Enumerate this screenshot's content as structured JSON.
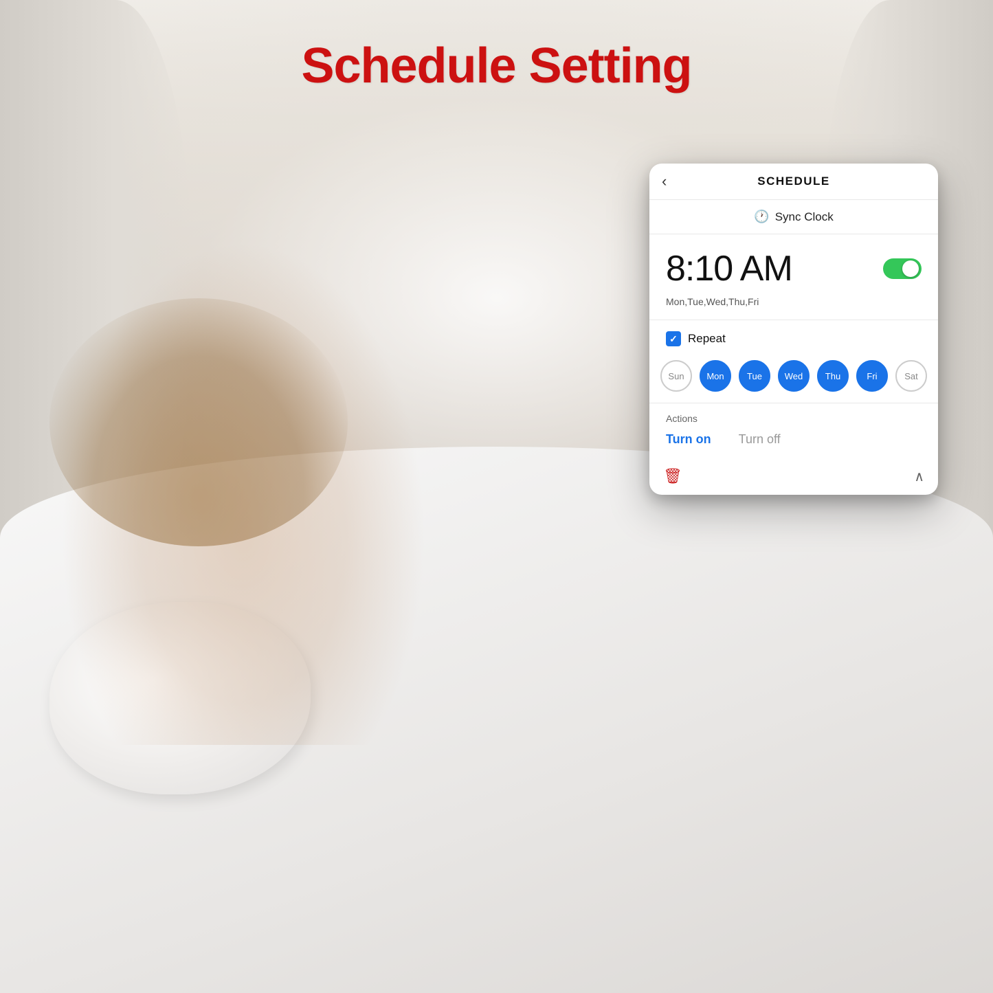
{
  "page": {
    "title": "Schedule Setting",
    "title_color": "#cc1111"
  },
  "app": {
    "header": {
      "back_label": "‹",
      "title": "SCHEDULE"
    },
    "sync_clock": {
      "icon": "🕐",
      "label": "Sync Clock"
    },
    "time": {
      "display": "8:10 AM",
      "toggle_on": true
    },
    "days_subtitle": "Mon,Tue,Wed,Thu,Fri",
    "repeat": {
      "checked": true,
      "label": "Repeat"
    },
    "days": [
      {
        "label": "Sun",
        "active": false
      },
      {
        "label": "Mon",
        "active": true
      },
      {
        "label": "Tue",
        "active": true
      },
      {
        "label": "Wed",
        "active": true
      },
      {
        "label": "Thu",
        "active": true
      },
      {
        "label": "Fri",
        "active": true
      },
      {
        "label": "Sat",
        "active": false
      }
    ],
    "actions": {
      "label": "Actions",
      "turn_on": "Turn on",
      "turn_off": "Turn off",
      "turn_on_active": true
    },
    "bottom": {
      "delete_icon": "🗑",
      "chevron": "∧"
    }
  }
}
